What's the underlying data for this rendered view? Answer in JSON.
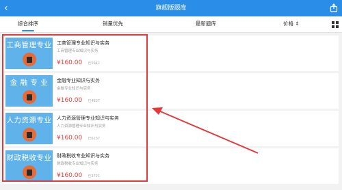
{
  "header": {
    "back_icon": "chevron-left-icon",
    "title": "旗舰版题库",
    "share_icon": "share-icon"
  },
  "tabs": [
    {
      "label": "综合排序",
      "active": true
    },
    {
      "label": "销量优先",
      "active": false
    },
    {
      "label": "最新题库",
      "active": false
    },
    {
      "label": "价格 ⇕",
      "active": false
    }
  ],
  "view_toggle_icon": "grid-view-icon",
  "products": [
    {
      "thumb": "工商管理专业",
      "name": "工商管理专业知识与实务",
      "subtitle": "工商管理专业知识与实务",
      "price": "¥160.00",
      "count": "已5942"
    },
    {
      "thumb": "金 融 专 业",
      "name": "金融专业知识与实务",
      "subtitle": "金融专业知识与实务",
      "price": "¥160.00",
      "count": "已4837"
    },
    {
      "thumb": "人力资源专业",
      "name": "人力资源管理专业知识与实务",
      "subtitle": "人力资源管理专业知识与实务",
      "price": "¥160.00",
      "count": "已6137"
    },
    {
      "thumb": "财政税收专业",
      "name": "财政税收专业知识与实务",
      "subtitle": "财政税收专业知识与实务",
      "price": "¥160.00",
      "count": "已3721"
    }
  ],
  "colors": {
    "header_bg": "#2a8ee8",
    "price": "#e53935",
    "annotation": "#e5383b",
    "thumb_bg": "#5fb2ea"
  }
}
